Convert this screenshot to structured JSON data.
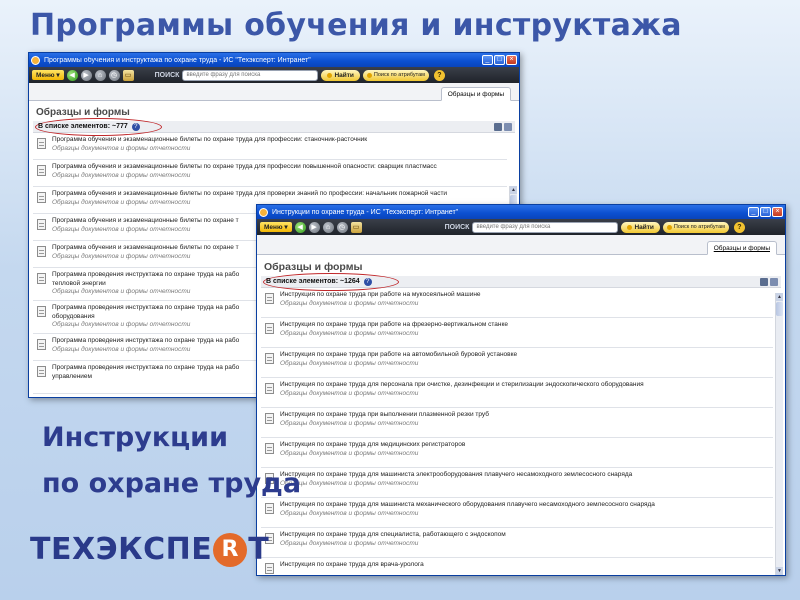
{
  "slide": {
    "title": "Программы обучения и инструктажа",
    "caption_line1": "Инструкции",
    "caption_line2": "по охране труда",
    "logo_part1": "ТЕХЭКСПЕ",
    "logo_mark": "R",
    "logo_part2": "Т"
  },
  "window1": {
    "title": "Программы обучения и инструктажа по охране труда - ИС \"Техэксперт: Интранет\"",
    "menu_label": "Меню",
    "search_label": "ПОИСК",
    "search_placeholder": "введите фразу для поиска",
    "find_label": "Найти",
    "attr_search_label": "Поиск по атрибутам",
    "tab_label": "Образцы и формы",
    "heading": "Образцы и формы",
    "count_label": "В списке элементов: ~777",
    "items": [
      {
        "title": "Программа обучения и экзаменационные билеты по охране труда для профессии: станочник-расточник",
        "sub": "Образцы документов и формы отчетности"
      },
      {
        "title": "Программа обучения и экзаменационные билеты по охране труда для профессии повышенной опасности: сварщик пластмасс",
        "sub": "Образцы документов и формы отчетности"
      },
      {
        "title": "Программа обучения и экзаменационные билеты по охране труда для проверки знаний по профессии: начальник пожарной части",
        "sub": "Образцы документов и формы отчетности"
      },
      {
        "title": "Программа обучения и экзаменационные билеты по охране т",
        "sub": "Образцы документов и формы отчетности"
      },
      {
        "title": "Программа обучения и экзаменационные билеты по охране т",
        "sub": "Образцы документов и формы отчетности"
      },
      {
        "title": "Программа проведения инструктажа по охране труда на рабо",
        "title2": "тепловой энергии",
        "sub": "Образцы документов и формы отчетности"
      },
      {
        "title": "Программа проведения инструктажа по охране труда на рабо",
        "title2": "оборудования",
        "sub": "Образцы документов и формы отчетности"
      },
      {
        "title": "Программа проведения инструктажа по охране труда на рабо",
        "sub": "Образцы документов и формы отчетности"
      },
      {
        "title": "Программа проведения инструктажа по охране труда на рабо",
        "title2": "управлением",
        "sub": ""
      }
    ]
  },
  "window2": {
    "title": "Инструкции по охране труда - ИС \"Техэксперт: Интранет\"",
    "menu_label": "Меню",
    "search_label": "ПОИСК",
    "search_placeholder": "введите фразу для поиска",
    "find_label": "Найти",
    "attr_search_label": "Поиск по атрибутам",
    "tab_label": "Образцы и формы",
    "heading": "Образцы и формы",
    "count_label": "В списке элементов: ~1264",
    "items": [
      {
        "title": "Инструкция по охране труда при работе на мукосеяльной машине",
        "sub": "Образцы документов и формы отчетности"
      },
      {
        "title": "Инструкция по охране труда при работе на фрезерно-вертикальном станке",
        "sub": "Образцы документов и формы отчетности"
      },
      {
        "title": "Инструкция по охране труда при работе на автомобильной буровой установке",
        "sub": "Образцы документов и формы отчетности"
      },
      {
        "title": "Инструкция по охране труда для персонала при очистке, дезинфекции и стерилизации эндоскопического оборудования",
        "sub": "Образцы документов и формы отчетности"
      },
      {
        "title": "Инструкция по охране труда при выполнении плазменной резки труб",
        "sub": "Образцы документов и формы отчетности"
      },
      {
        "title": "Инструкция по охране труда для медицинских регистраторов",
        "sub": "Образцы документов и формы отчетности"
      },
      {
        "title": "Инструкция по охране труда для машиниста электрооборудования плавучего несамоходного землесосного снаряда",
        "sub": "Образцы документов и формы отчетности"
      },
      {
        "title": "Инструкция по охране труда для машиниста механического оборудования плавучего несамоходного землесосного снаряда",
        "sub": "Образцы документов и формы отчетности"
      },
      {
        "title": "Инструкция по охране труда для специалиста, работающего с эндоскопом",
        "sub": "Образцы документов и формы отчетности"
      },
      {
        "title": "Инструкция по охране труда для врача-уролога",
        "sub": ""
      }
    ]
  }
}
